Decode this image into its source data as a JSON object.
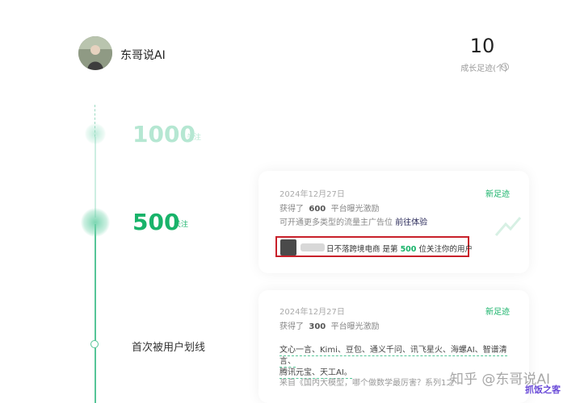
{
  "profile": {
    "name": "东哥说AI",
    "stat_value": "10",
    "stat_label": "成长足迹(个)",
    "help_icon": "question-circle-icon"
  },
  "milestones": [
    {
      "number": "1000",
      "unit": "关注"
    },
    {
      "number": "500",
      "unit": "关注"
    },
    {
      "text": "首次被用户划线"
    }
  ],
  "cards": [
    {
      "date": "2024年12月27日",
      "tag": "新足迹",
      "reward_prefix": "获得了",
      "reward_amount": "600",
      "reward_suffix": "平台曝光激励",
      "desc": "可开通更多类型的流量主广告位",
      "desc_link": "前往体验",
      "highlight": {
        "prefix": "日不落跨境电商 是第",
        "number": "500",
        "suffix": "位关注你的用户"
      }
    },
    {
      "date": "2024年12月27日",
      "tag": "新足迹",
      "reward_prefix": "获得了",
      "reward_amount": "300",
      "reward_suffix": "平台曝光激励",
      "tags_line1": "文心一言、Kimi、豆包、通义千问、讯飞星火、海螺AI、智谱清言、",
      "tags_line2": "腾讯元宝、天工AI。",
      "source": "来自《国内大模型，哪个做数学最厉害？系列1之"
    }
  ],
  "watermark": "知乎 @东哥说AI",
  "site_badge": "抓饭之客"
}
